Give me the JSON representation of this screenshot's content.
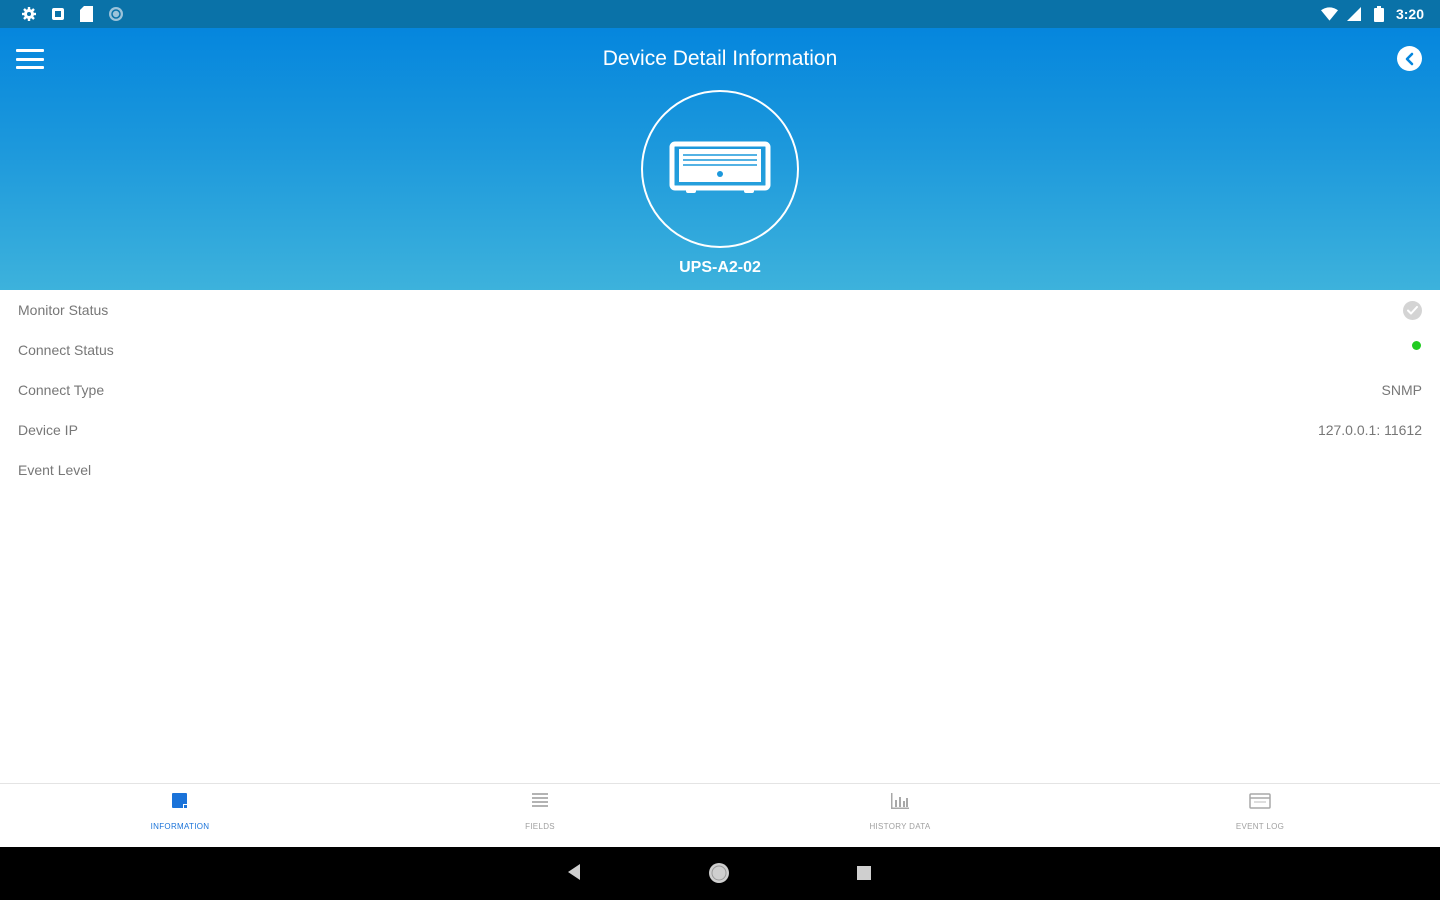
{
  "status_bar": {
    "time": "3:20",
    "left_icons": [
      "settings-icon",
      "notification-icon",
      "sd-card-icon",
      "sync-icon"
    ],
    "right_icons": [
      "wifi-icon",
      "signal-icon",
      "battery-icon"
    ]
  },
  "header": {
    "title": "Device Detail Information",
    "device_name": "UPS-A2-02",
    "device_icon": "ups-device-icon"
  },
  "info": [
    {
      "label": "Monitor Status",
      "value": "",
      "indicator": "check"
    },
    {
      "label": "Connect Status",
      "value": "",
      "indicator": "green-dot"
    },
    {
      "label": "Connect Type",
      "value": "SNMP"
    },
    {
      "label": "Device IP",
      "value": "127.0.0.1: 11612"
    },
    {
      "label": "Event Level",
      "value": ""
    }
  ],
  "bottom_nav": {
    "information": "INFORMATION",
    "fields": "FIELDS",
    "history_data": "HISTORY DATA",
    "event_log": "EVENT LOG"
  },
  "colors": {
    "header_top": "#0586dd",
    "header_bottom": "#3db2dc",
    "status_bar": "#0a72a8",
    "accent": "#1a73d9",
    "connected": "#22cc22"
  }
}
